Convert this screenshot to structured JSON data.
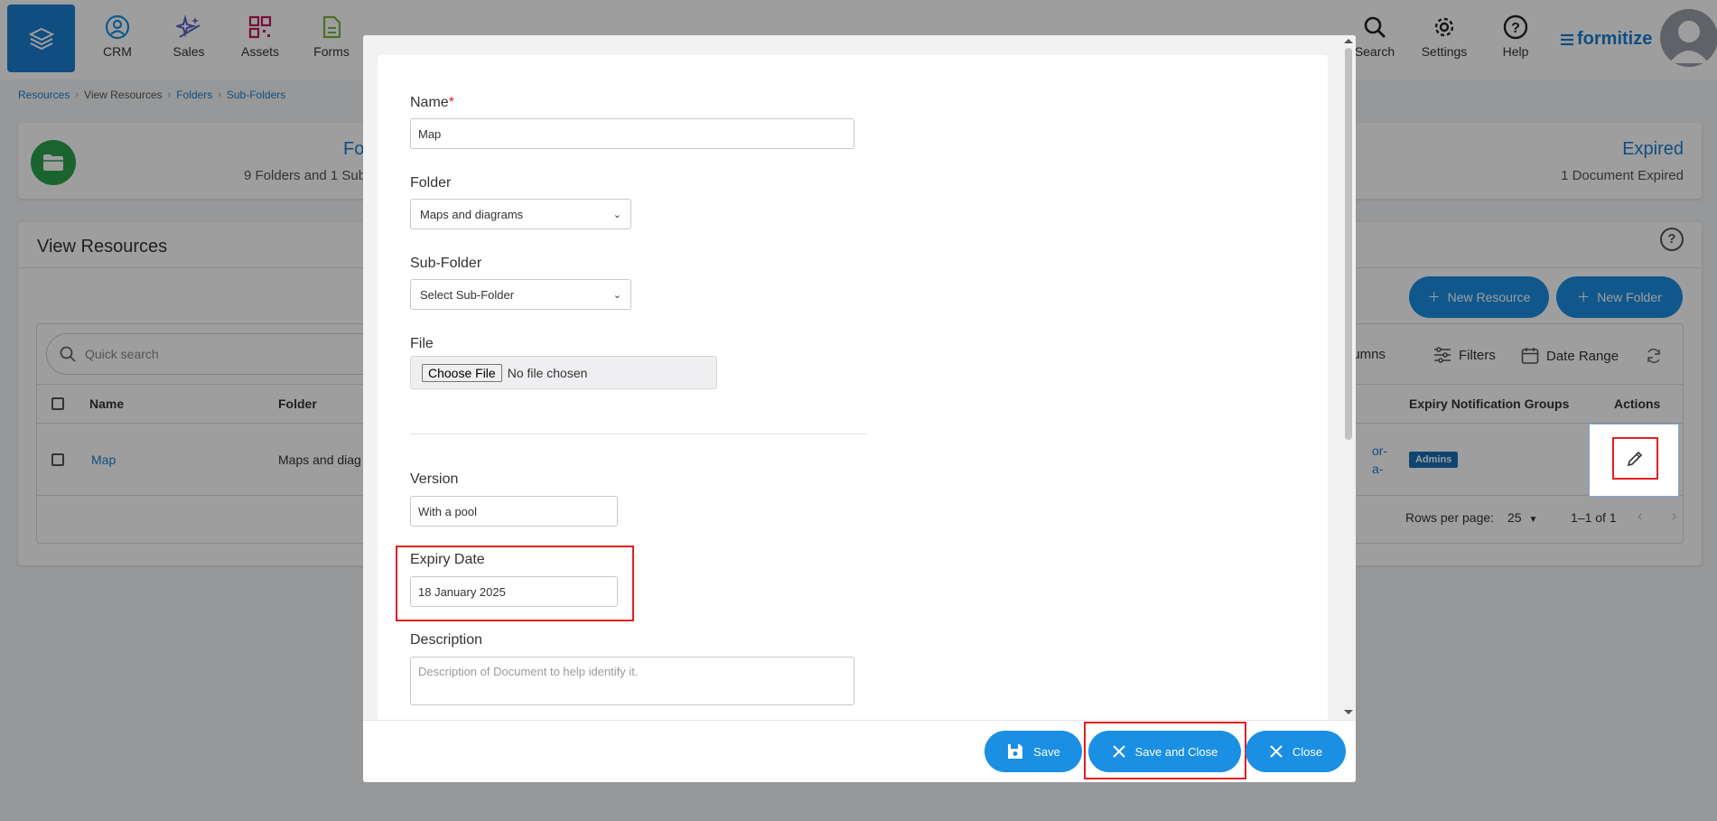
{
  "nav": {
    "items": [
      {
        "label": "CRM",
        "icon": "user-circle-icon"
      },
      {
        "label": "Sales",
        "icon": "sparkle-icon"
      },
      {
        "label": "Assets",
        "icon": "qr-code-icon"
      },
      {
        "label": "Forms",
        "icon": "document-icon"
      }
    ],
    "right_items": [
      {
        "label": "Search",
        "icon": "search-icon"
      },
      {
        "label": "Settings",
        "icon": "gear-icon"
      },
      {
        "label": "Help",
        "icon": "help-circle-icon"
      }
    ],
    "brand": "formitize"
  },
  "breadcrumb": [
    "Resources",
    "View Resources",
    "Folders",
    "Sub-Folders"
  ],
  "summary": {
    "left_title": "Fo",
    "left_sub": "9 Folders and 1 Sub",
    "right_title": "Expired",
    "right_sub": "1 Document Expired"
  },
  "resources": {
    "title": "View Resources",
    "new_resource": "New Resource",
    "new_folder": "New Folder",
    "search_placeholder": "Quick search",
    "columns_label": "lumns",
    "filters_label": "Filters",
    "date_range_label": "Date Range",
    "headers": {
      "name": "Name",
      "folder": "Folder",
      "expiry_groups": "Expiry Notification Groups",
      "actions": "Actions"
    },
    "row": {
      "name": "Map",
      "folder": "Maps and diag",
      "partial_a": "or-",
      "partial_b": "a-",
      "group_badge": "Admins"
    },
    "rows_per_page_label": "Rows per page:",
    "rows_per_page": "25",
    "range": "1–1 of 1"
  },
  "modal": {
    "name_label": "Name",
    "required_mark": "*",
    "name_value": "Map",
    "folder_label": "Folder",
    "folder_value": "Maps and diagrams",
    "subfolder_label": "Sub-Folder",
    "subfolder_value": "Select Sub-Folder",
    "file_label": "File",
    "choose_file": "Choose File",
    "no_file": "No file chosen",
    "version_label": "Version",
    "version_value": "With a pool",
    "expiry_label": "Expiry Date",
    "expiry_value": "18 January 2025",
    "description_label": "Description",
    "description_placeholder": "Description of Document to help identify it.",
    "save": "Save",
    "save_close": "Save and Close",
    "close": "Close"
  },
  "colors": {
    "accent": "#1a8fe3",
    "brand": "#1a7fd1",
    "highlight": "#e41f1f",
    "folder_green": "#2ba24c"
  }
}
